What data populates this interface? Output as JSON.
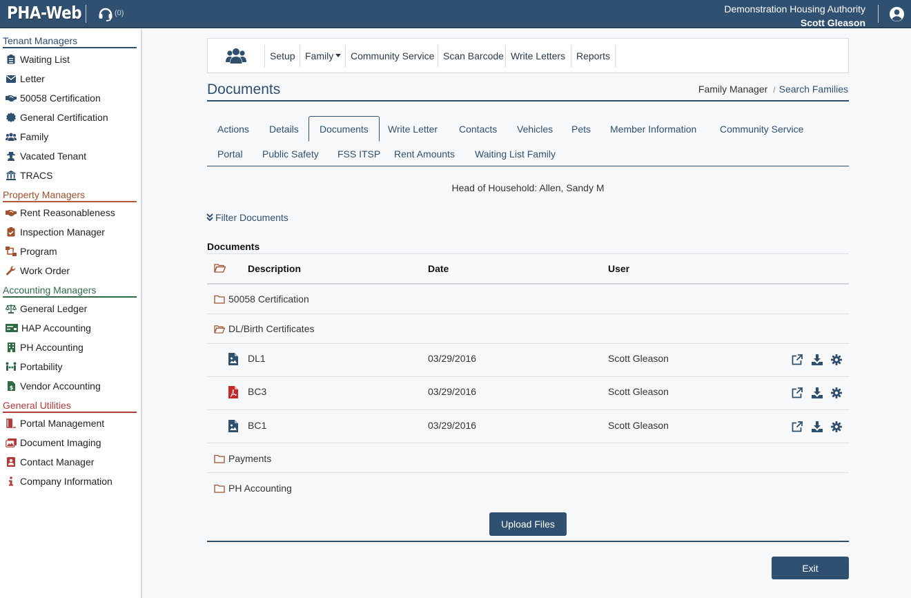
{
  "header": {
    "logo": "PHA-Web",
    "support_count": "(0)",
    "organization": "Demonstration Housing Authority",
    "user": "Scott Gleason"
  },
  "sidebar": {
    "tenant": {
      "title": "Tenant Managers",
      "items": [
        "Waiting List",
        "Letter",
        "50058 Certification",
        "General Certification",
        "Family",
        "Vacated Tenant",
        "TRACS"
      ]
    },
    "property": {
      "title": "Property Managers",
      "items": [
        "Rent Reasonableness",
        "Inspection Manager",
        "Program",
        "Work Order"
      ]
    },
    "accounting": {
      "title": "Accounting Managers",
      "items": [
        "General Ledger",
        "HAP Accounting",
        "PH Accounting",
        "Portability",
        "Vendor Accounting"
      ]
    },
    "general": {
      "title": "General Utilities",
      "items": [
        "Portal Management",
        "Document Imaging",
        "Contact Manager",
        "Company Information"
      ]
    }
  },
  "nav": {
    "items": [
      "Setup",
      "Family",
      "Community Service",
      "Scan Barcode",
      "Write Letters",
      "Reports"
    ]
  },
  "page": {
    "title": "Documents",
    "breadcrumb": [
      "Family Manager",
      "Search Families"
    ]
  },
  "tabs": {
    "row1": [
      "Actions",
      "Details",
      "Documents",
      "Write Letter",
      "Contacts",
      "Vehicles",
      "Pets",
      "Member Information",
      "Community Service"
    ],
    "row2": [
      "Portal",
      "Public Safety",
      "FSS ITSP",
      "Rent Amounts",
      "Waiting List Family"
    ],
    "active": "Documents"
  },
  "household": "Head of Household: Allen, Sandy M",
  "filter_label": "Filter Documents",
  "documents": {
    "section_label": "Documents",
    "columns": {
      "description": "Description",
      "date": "Date",
      "user": "User"
    },
    "folders": [
      "50058 Certification",
      "DL/Birth Certificates",
      "Payments",
      "PH Accounting"
    ],
    "files": [
      {
        "name": "DL1",
        "date": "03/29/2016",
        "user": "Scott Gleason",
        "type": "image"
      },
      {
        "name": "BC3",
        "date": "03/29/2016",
        "user": "Scott Gleason",
        "type": "pdf"
      },
      {
        "name": "BC1",
        "date": "03/29/2016",
        "user": "Scott Gleason",
        "type": "image"
      }
    ]
  },
  "buttons": {
    "upload": "Upload Files",
    "exit": "Exit"
  },
  "colors": {
    "primary": "#2f5070",
    "pdf": "#c62828",
    "folder": "#a0522d"
  }
}
